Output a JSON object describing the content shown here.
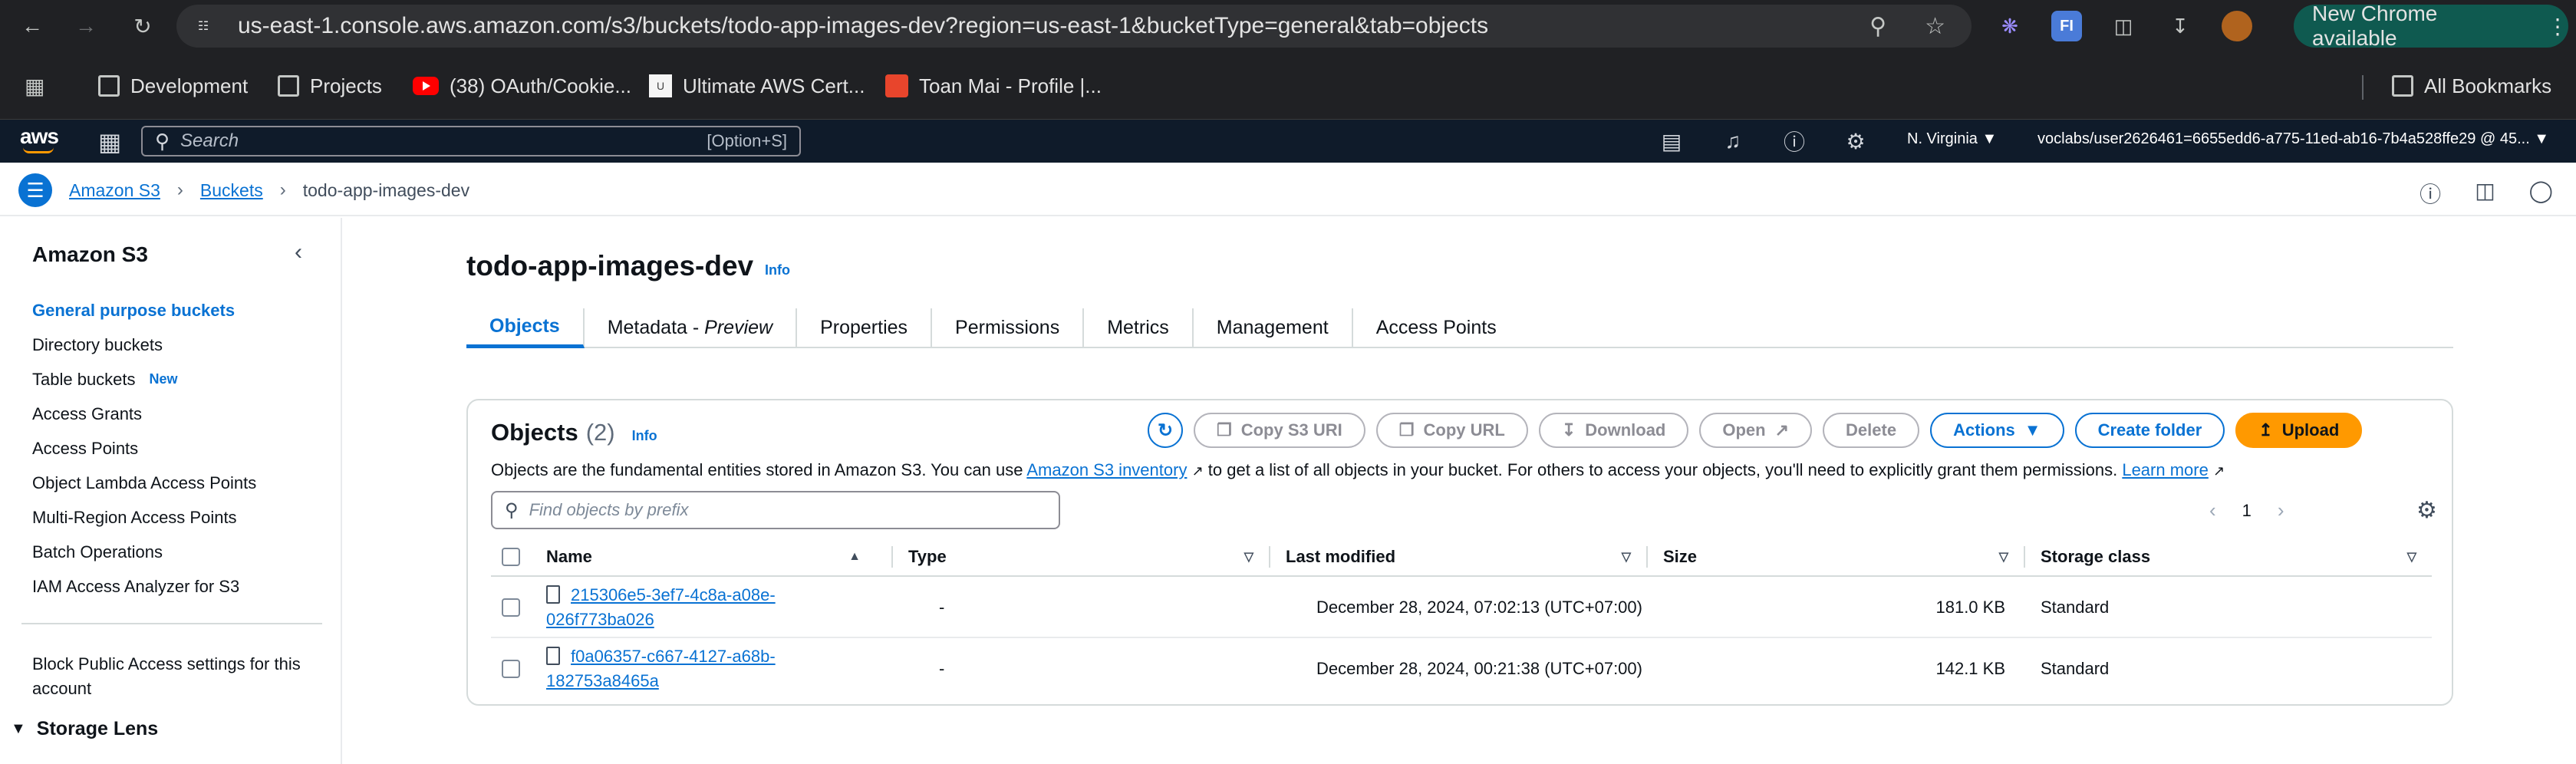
{
  "browser": {
    "url": "us-east-1.console.aws.amazon.com/s3/buckets/todo-app-images-dev?region=us-east-1&bucketType=general&tab=objects",
    "new_chrome": "New Chrome available",
    "bookmarks": [
      "Development",
      "Projects",
      "(38) OAuth/Cookie...",
      "Ultimate AWS Cert...",
      "Toan Mai - Profile |...",
      "All Bookmarks"
    ]
  },
  "aws_header": {
    "logo": "aws",
    "search_placeholder": "Search",
    "search_hint": "[Option+S]",
    "region": "N. Virginia ▼",
    "account": "voclabs/user2626461=6655edd6-a775-11ed-ab16-7b4a528ffe29 @ 45... ▼"
  },
  "breadcrumb": {
    "items": [
      "Amazon S3",
      "Buckets",
      "todo-app-images-dev"
    ]
  },
  "sidebar": {
    "title": "Amazon S3",
    "items": [
      {
        "label": "General purpose buckets",
        "badge": ""
      },
      {
        "label": "Directory buckets",
        "badge": ""
      },
      {
        "label": "Table buckets",
        "badge": "New"
      },
      {
        "label": "Access Grants",
        "badge": ""
      },
      {
        "label": "Access Points",
        "badge": ""
      },
      {
        "label": "Object Lambda Access Points",
        "badge": ""
      },
      {
        "label": "Multi-Region Access Points",
        "badge": ""
      },
      {
        "label": "Batch Operations",
        "badge": ""
      },
      {
        "label": "IAM Access Analyzer for S3",
        "badge": ""
      }
    ],
    "block_public": "Block Public Access settings for this account",
    "storage_lens": "Storage Lens"
  },
  "bucket": {
    "name": "todo-app-images-dev",
    "info": "Info",
    "tabs": [
      "Objects",
      "Metadata - ",
      "Properties",
      "Permissions",
      "Metrics",
      "Management",
      "Access Points"
    ],
    "metadata_preview": "Preview"
  },
  "objects": {
    "title": "Objects",
    "count": "(2)",
    "info": "Info",
    "desc_1": "Objects are the fundamental entities stored in Amazon S3. You can use ",
    "desc_link_1": "Amazon S3 inventory",
    "desc_2": " to get a list of all objects in your bucket. For others to access your objects, you'll need to explicitly grant them permissions. ",
    "desc_link_2": "Learn more",
    "buttons": {
      "copy_s3_uri": "Copy S3 URI",
      "copy_url": "Copy URL",
      "download": "Download",
      "open": "Open",
      "delete": "Delete",
      "actions": "Actions",
      "create_folder": "Create folder",
      "upload": "Upload"
    },
    "search_placeholder": "Find objects by prefix",
    "page": "1",
    "columns": [
      "Name",
      "Type",
      "Last modified",
      "Size",
      "Storage class"
    ],
    "rows": [
      {
        "name": "215306e5-3ef7-4c8a-a08e-026f773ba026",
        "type": "-",
        "modified": "December 28, 2024, 07:02:13 (UTC+07:00)",
        "size": "181.0 KB",
        "storage": "Standard"
      },
      {
        "name": "f0a06357-c667-4127-a68b-182753a8465a",
        "type": "-",
        "modified": "December 28, 2024, 00:21:38 (UTC+07:00)",
        "size": "142.1 KB",
        "storage": "Standard"
      }
    ]
  }
}
